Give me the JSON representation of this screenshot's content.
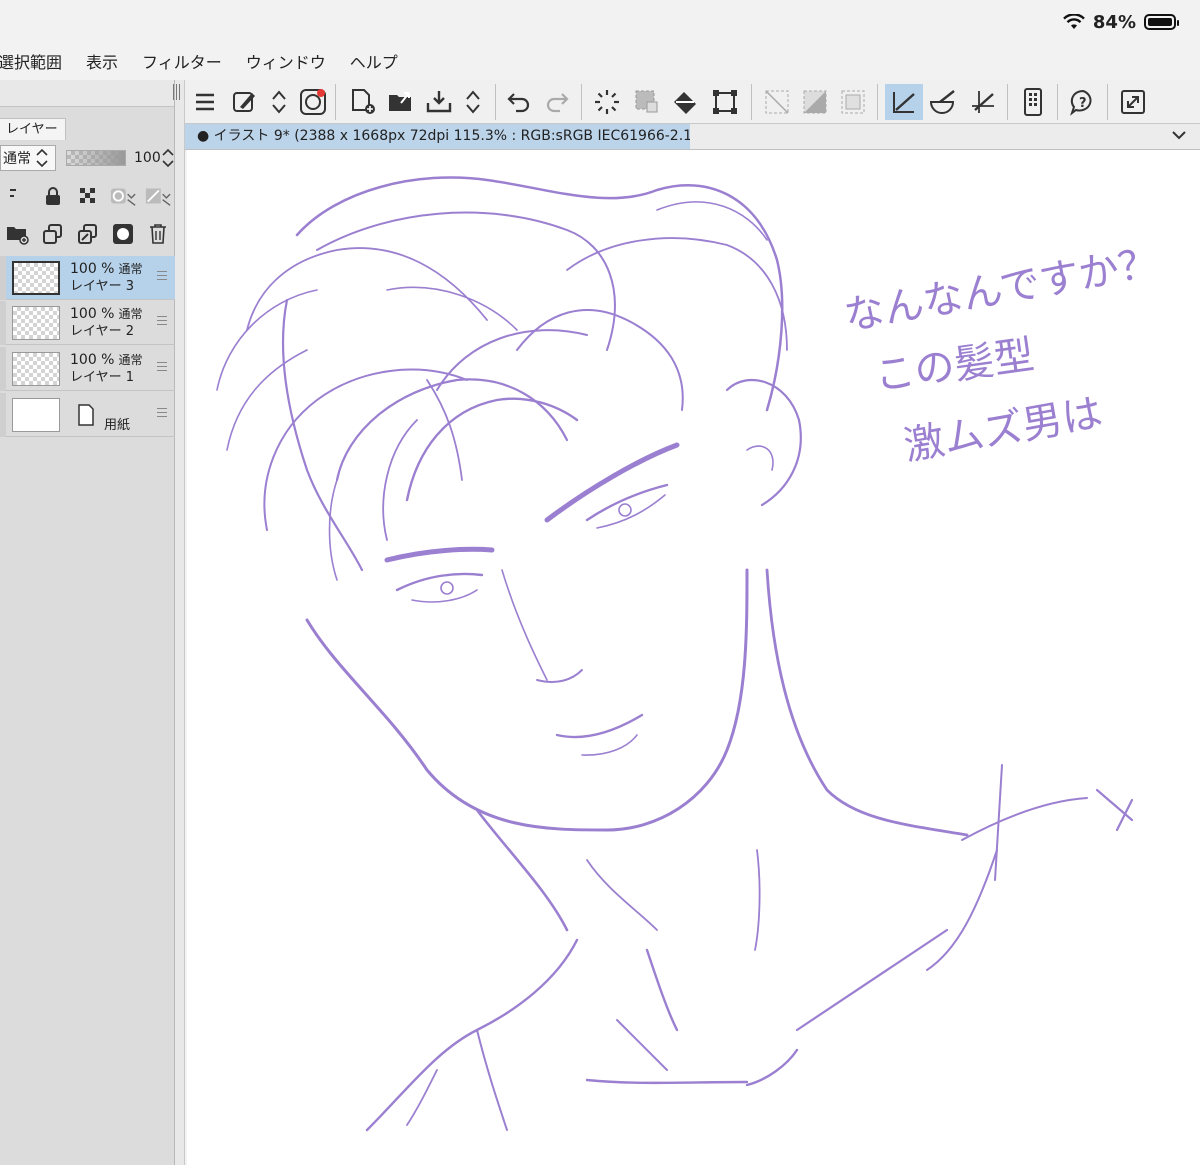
{
  "status": {
    "battery_text": "84%",
    "icons": [
      "wifi-icon",
      "battery-icon"
    ]
  },
  "menu": [
    "選択範囲",
    "表示",
    "フィルター",
    "ウィンドウ",
    "ヘルプ"
  ],
  "layer_panel": {
    "tab_label": "レイヤー",
    "blend_mode": "通常",
    "opacity": "100",
    "layers": [
      {
        "opacity": "100 %",
        "mode": "通常",
        "name": "レイヤー 3",
        "selected": true
      },
      {
        "opacity": "100 %",
        "mode": "通常",
        "name": "レイヤー 2",
        "selected": false
      },
      {
        "opacity": "100 %",
        "mode": "通常",
        "name": "レイヤー 1",
        "selected": false
      },
      {
        "name": "用紙",
        "paper": true
      }
    ]
  },
  "document": {
    "tab_title": "● イラスト 9* (2388 x 1668px 72dpi 115.3% : RGB:sRGB IEC61966-2.1)"
  },
  "colors": {
    "ink": "#9b7fd0",
    "accent": "#b6d2ea",
    "panel": "#dcdcdc"
  }
}
